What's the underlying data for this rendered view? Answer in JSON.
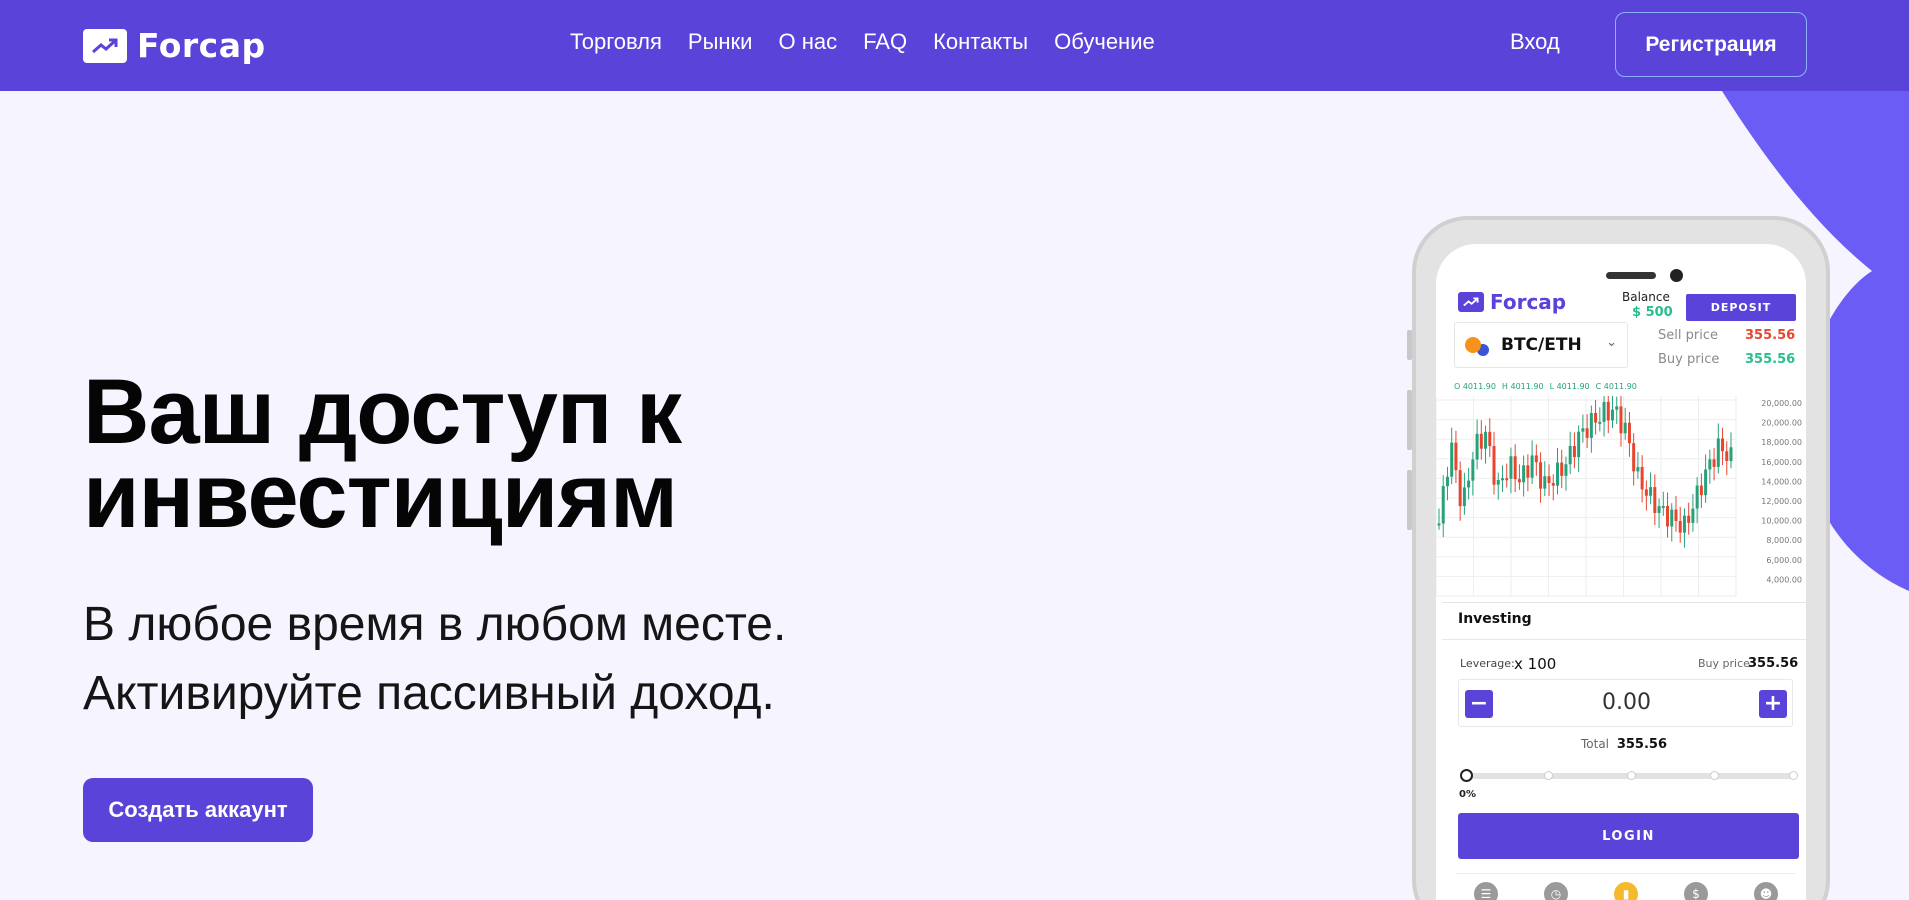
{
  "header": {
    "brand": "Forcap",
    "nav": [
      {
        "label": "Торговля"
      },
      {
        "label": "Рынки"
      },
      {
        "label": "О нас"
      },
      {
        "label": "FAQ"
      },
      {
        "label": "Контакты"
      },
      {
        "label": "Обучение"
      }
    ],
    "login_label": "Вход",
    "register_label": "Регистрация"
  },
  "hero": {
    "title_line1": "Ваш доступ к",
    "title_line2": "инвестициям",
    "subtitle_line1": "В любое время в любом месте.",
    "subtitle_line2": "Активируйте пассивный доход.",
    "cta_label": "Создать аккаунт"
  },
  "app": {
    "brand": "Forcap",
    "balance_label": "Balance",
    "balance_value": "$ 500",
    "deposit_label": "DEPOSIT",
    "pair": "BTC/ETH",
    "sell_price_label": "Sell price",
    "sell_price": "355.56",
    "buy_price_label": "Buy price",
    "buy_price": "355.56",
    "ohlc": [
      "O 4011.90",
      "H 4011.90",
      "L 4011.90",
      "C 4011.90"
    ],
    "y_ticks": [
      "20,000.00",
      "20,000.00",
      "18,000.00",
      "16,000.00",
      "14,000.00",
      "12,000.00",
      "10,000.00",
      "8,000.00",
      "6,000.00",
      "4,000.00"
    ],
    "investing_title": "Investing",
    "leverage_label": "Leverage:",
    "leverage_value": "x 100",
    "buy_price_small_label": "Buy price",
    "buy_price_small": "355.56",
    "amount": "0.00",
    "total_label": "Total",
    "total_value": "355.56",
    "slider_percent": "0%",
    "slider_level": 0,
    "login_label": "LOGIN"
  },
  "colors": {
    "brand": "#5a43d9",
    "accent_blob": "#6b5cf6",
    "sell_red": "#e8452f",
    "buy_green": "#27c08a"
  },
  "chart_data": {
    "type": "line",
    "series": [
      {
        "values": [
          9800,
          16200,
          11000,
          15800,
          17000,
          12500,
          14500,
          13200,
          15000,
          12800,
          13600,
          14800,
          16800,
          17800,
          18600,
          18900,
          17200,
          13500,
          12000,
          10800,
          10200,
          9500,
          11800,
          14200,
          16000,
          15000
        ]
      }
    ],
    "ylim": [
      4000,
      20000
    ]
  }
}
